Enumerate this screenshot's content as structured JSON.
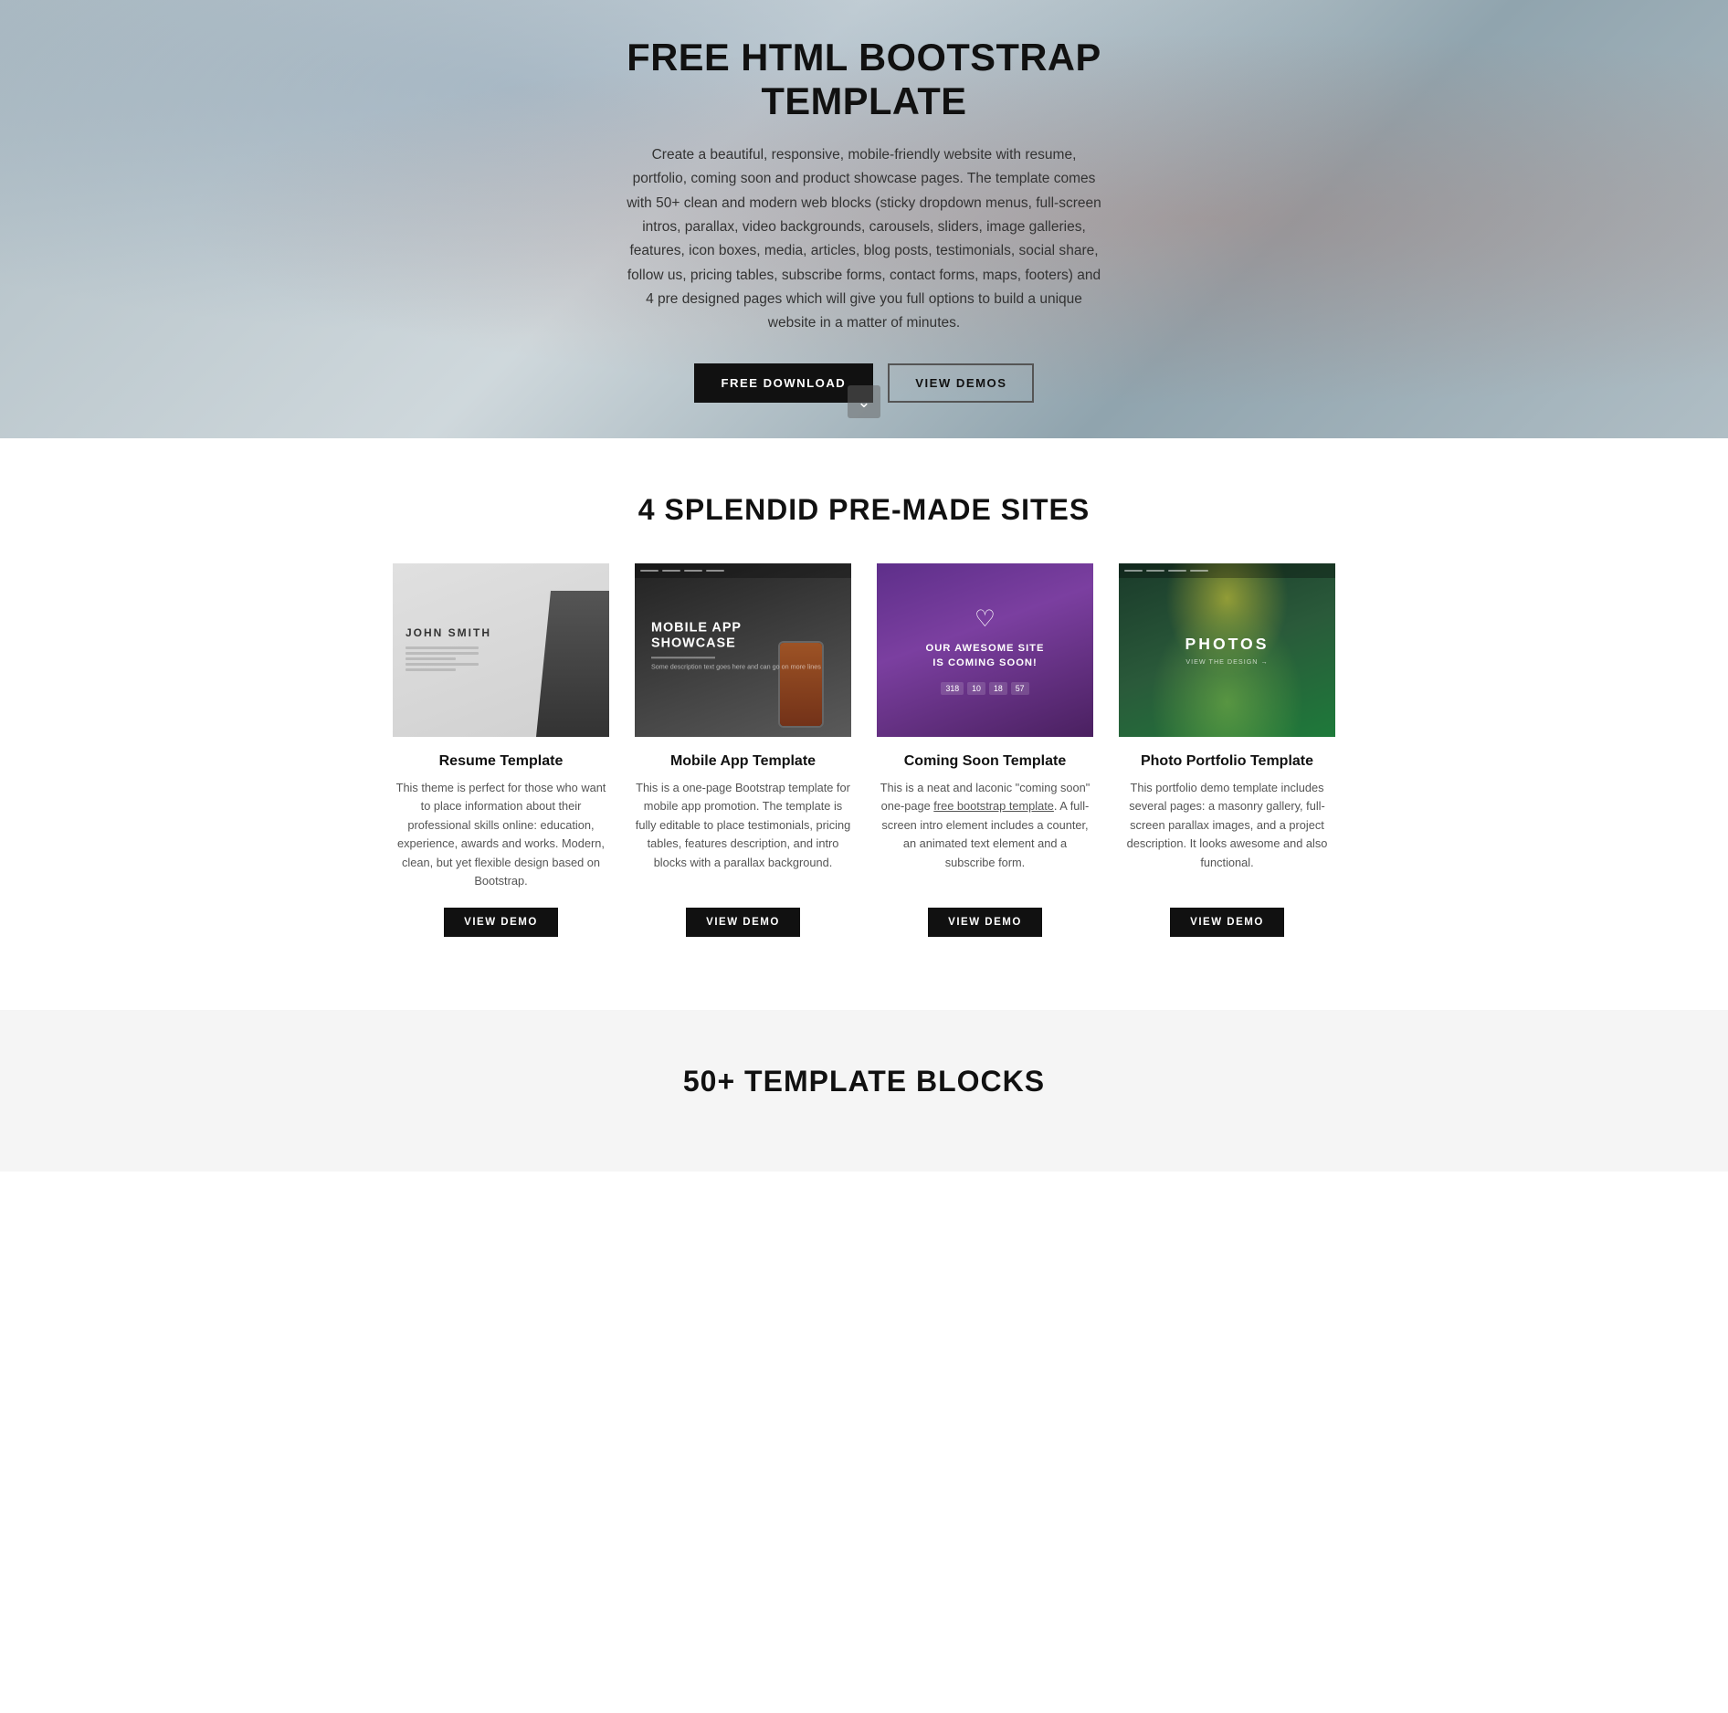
{
  "hero": {
    "title": "FREE HTML BOOTSTRAP TEMPLATE",
    "description": "Create a beautiful, responsive, mobile-friendly website with resume, portfolio, coming soon and product showcase pages. The template comes with 50+ clean and modern web blocks (sticky dropdown menus, full-screen intros, parallax, video backgrounds, carousels, sliders, image galleries, features, icon boxes, media, articles, blog posts, testimonials, social share, follow us, pricing tables, subscribe forms, contact forms, maps, footers) and 4 pre designed pages which will give you full options to build a unique website in a matter of minutes.",
    "btn_download": "FREE DOWNLOAD",
    "btn_demos": "VIEW DEMOS",
    "scroll_icon": "⌄"
  },
  "premade": {
    "section_title": "4 SPLENDID PRE-MADE SITES",
    "cards": [
      {
        "id": "resume",
        "name": "Resume Template",
        "description": "This theme is perfect for those who want to place information about their professional skills online: education, experience, awards and works. Modern, clean, but yet flexible design based on Bootstrap.",
        "btn_label": "VIEW DEMO",
        "thumb_type": "resume"
      },
      {
        "id": "mobile-app",
        "name": "Mobile App Template",
        "description": "This is a one-page Bootstrap template for mobile app promotion. The template is fully editable to place testimonials, pricing tables, features description, and intro blocks with a parallax background.",
        "btn_label": "VIEW DEMO",
        "thumb_type": "mobile",
        "thumb_title": "MOBILE APP SHOWCASE"
      },
      {
        "id": "coming-soon",
        "name": "Coming Soon Template",
        "description": "This is a neat and laconic \"coming soon\" one-page free bootstrap template. A full-screen intro element includes a counter, an animated text element and a subscribe form.",
        "btn_label": "VIEW DEMO",
        "thumb_type": "coming",
        "thumb_text": "OUR AWESOME SITE IS COMING SOON!",
        "counter": [
          "318",
          "10",
          "18",
          "57"
        ]
      },
      {
        "id": "photo-portfolio",
        "name": "Photo Portfolio Template",
        "description": "This portfolio demo template includes several pages: a masonry gallery, full-screen parallax images, and a project description. It looks awesome and also functional.",
        "btn_label": "VIEW DEMO",
        "thumb_type": "photo",
        "thumb_text": "PHOTOS"
      }
    ]
  },
  "blocks": {
    "section_title": "50+ TEMPLATE BLOCKS"
  }
}
